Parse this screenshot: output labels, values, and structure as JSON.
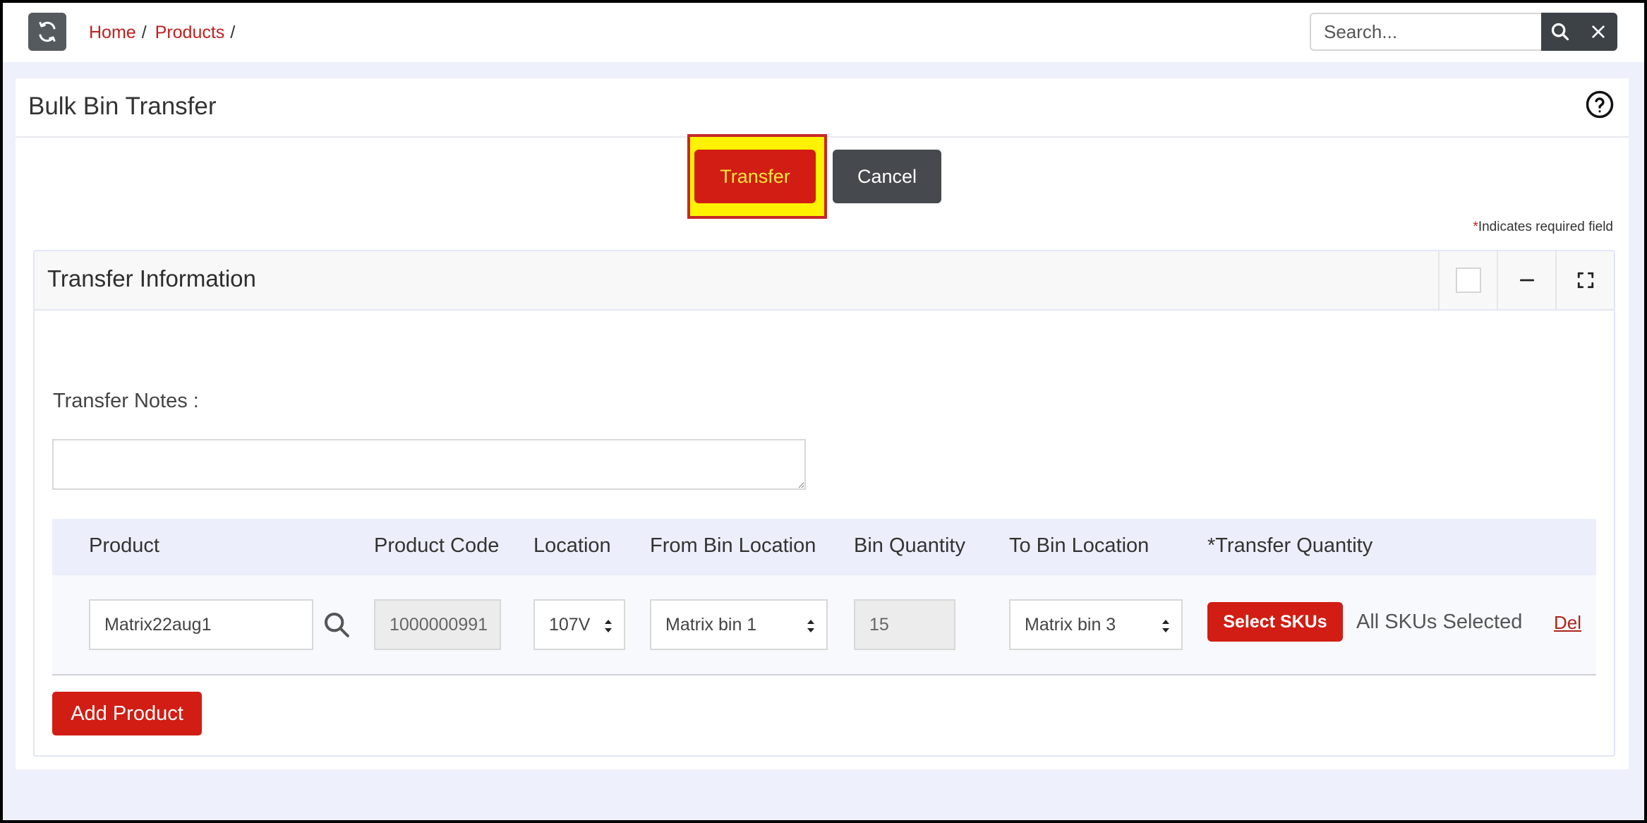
{
  "breadcrumb": {
    "home": "Home",
    "products": "Products",
    "separator": "/"
  },
  "search": {
    "placeholder": "Search..."
  },
  "page": {
    "title": "Bulk Bin Transfer",
    "transfer_label": "Transfer",
    "cancel_label": "Cancel",
    "required_star": "*",
    "required_text": "Indicates required field"
  },
  "panel": {
    "title": "Transfer Information",
    "notes_label": "Transfer Notes :",
    "notes_value": ""
  },
  "table": {
    "headers": {
      "product": "Product",
      "product_code": "Product Code",
      "location": "Location",
      "from_bin": "From Bin Location",
      "bin_qty": "Bin Quantity",
      "to_bin": "To Bin Location",
      "transfer_qty": "*Transfer Quantity"
    },
    "row": {
      "product": "Matrix22aug1",
      "product_code": "1000000991",
      "location": "107V",
      "from_bin": "Matrix bin 1",
      "bin_qty": "15",
      "to_bin": "Matrix bin 3",
      "select_skus": "Select SKUs",
      "skus_status": "All SKUs Selected",
      "delete": "Del"
    }
  },
  "add_product_label": "Add Product",
  "colors": {
    "brand_red": "#d11d13",
    "link_red": "#c21f1f",
    "dark_button": "#46494d",
    "highlight_yellow": "#fff200"
  },
  "icons": {
    "refresh": "refresh-icon",
    "search": "search-icon",
    "close": "close-icon",
    "help": "help-circle-icon",
    "minimize": "minus-icon",
    "fullscreen": "expand-icon",
    "product_search": "search-icon"
  }
}
